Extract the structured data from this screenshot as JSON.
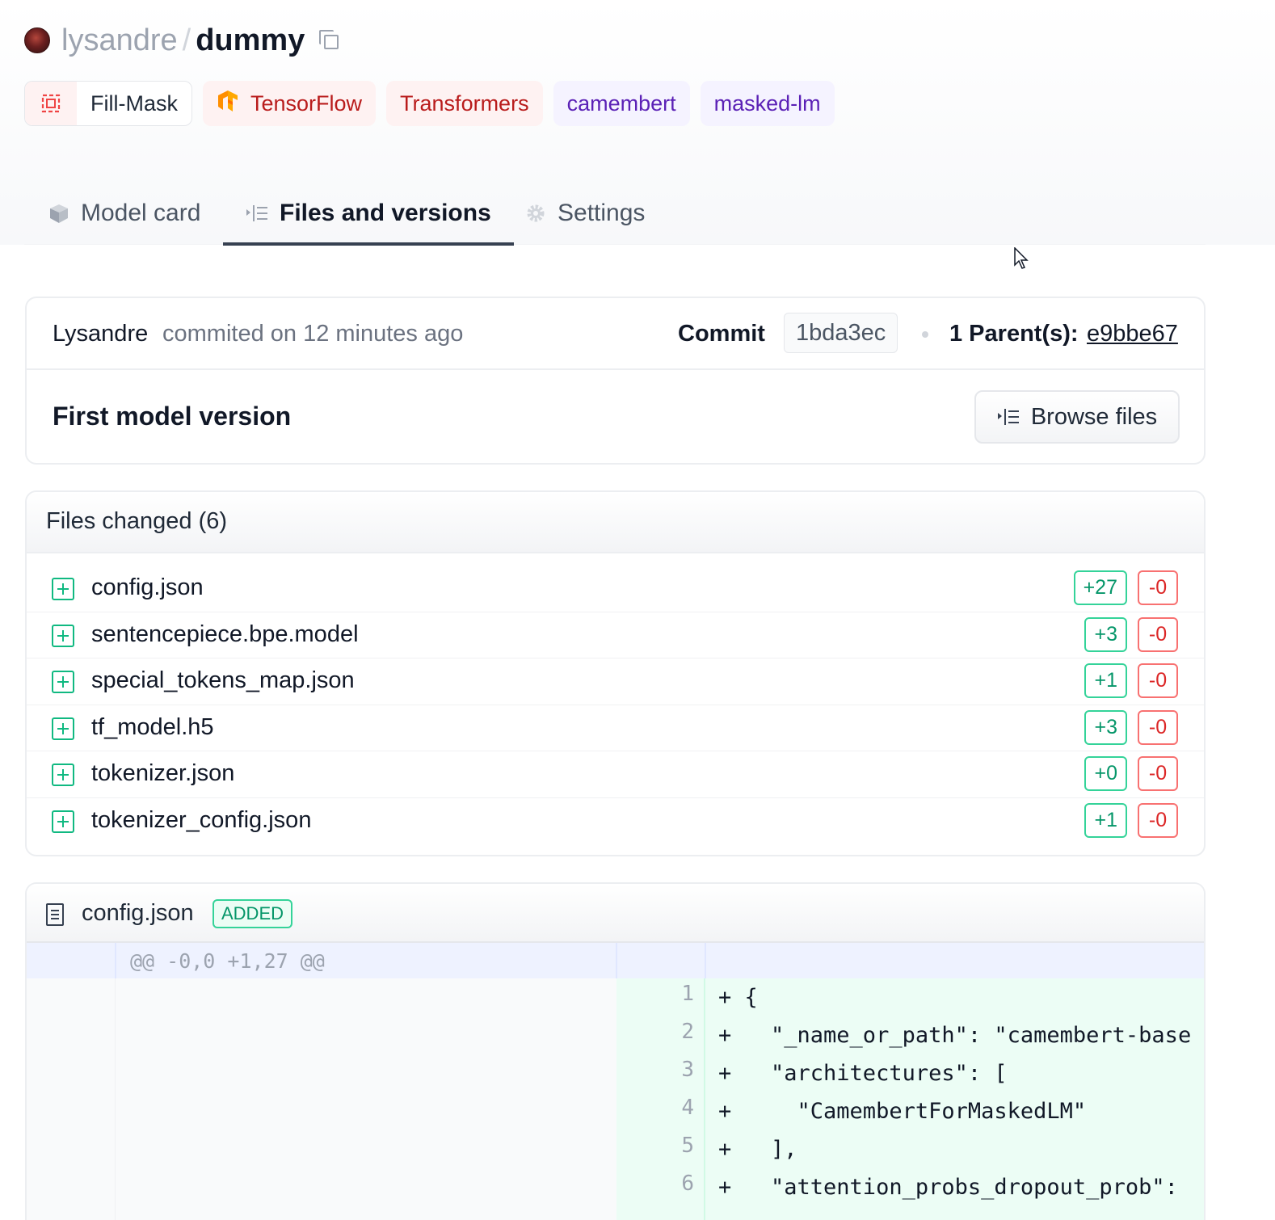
{
  "repo": {
    "owner": "lysandre",
    "separator": "/",
    "name": "dummy"
  },
  "tags": [
    {
      "label": "Fill-Mask",
      "icon": "fill-mask-icon"
    },
    {
      "label": "TensorFlow",
      "icon": "tensorflow-logo-icon"
    },
    {
      "label": "Transformers"
    },
    {
      "label": "camembert"
    },
    {
      "label": "masked-lm"
    }
  ],
  "tabs": [
    {
      "label": "Model card",
      "icon": "cube-icon"
    },
    {
      "label": "Files and versions",
      "icon": "file-list-icon",
      "active": true
    },
    {
      "label": "Settings",
      "icon": "gear-icon"
    }
  ],
  "commit": {
    "author": "Lysandre",
    "when": "commited on 12 minutes ago",
    "commit_label": "Commit",
    "hash": "1bda3ec",
    "parents_label": "1 Parent(s):",
    "parent_hash": "e9bbe67",
    "message": "First model version",
    "browse_label": "Browse files"
  },
  "files_changed": {
    "title": "Files changed (6)",
    "files": [
      {
        "name": "config.json",
        "added": "+27",
        "removed": "-0"
      },
      {
        "name": "sentencepiece.bpe.model",
        "added": "+3",
        "removed": "-0"
      },
      {
        "name": "special_tokens_map.json",
        "added": "+1",
        "removed": "-0"
      },
      {
        "name": "tf_model.h5",
        "added": "+3",
        "removed": "-0"
      },
      {
        "name": "tokenizer.json",
        "added": "+0",
        "removed": "-0"
      },
      {
        "name": "tokenizer_config.json",
        "added": "+1",
        "removed": "-0"
      }
    ]
  },
  "diff": {
    "file_name": "config.json",
    "status": "ADDED",
    "hunk": "@@ -0,0 +1,27 @@",
    "lines": [
      {
        "num": "1",
        "code": "+ {"
      },
      {
        "num": "2",
        "code": "+   \"_name_or_path\": \"camembert-base"
      },
      {
        "num": "3",
        "code": "+   \"architectures\": ["
      },
      {
        "num": "4",
        "code": "+     \"CamembertForMaskedLM\""
      },
      {
        "num": "5",
        "code": "+   ],"
      },
      {
        "num": "6",
        "code": "+   \"attention_probs_dropout_prob\":"
      }
    ]
  },
  "colors": {
    "added": "#10b981",
    "removed": "#ef4444",
    "diff_added_bg": "#ecfdf5",
    "hunk_bg": "#eef2ff",
    "purple_tag": "#5b21b6",
    "red_tag": "#b91c1c"
  }
}
